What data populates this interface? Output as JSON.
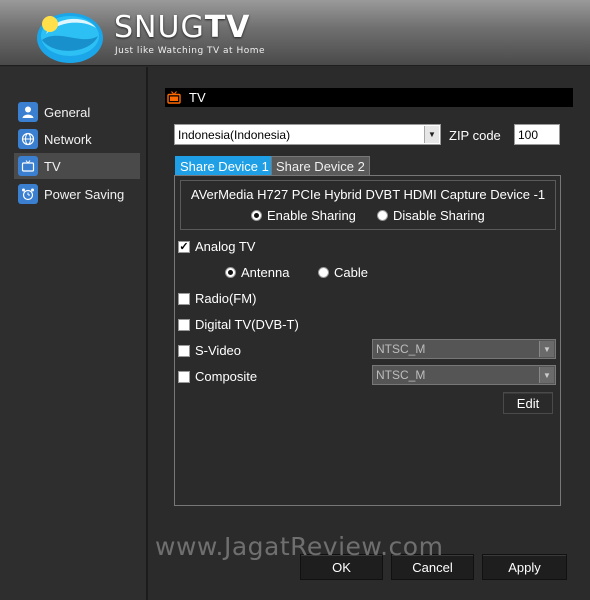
{
  "app": {
    "brand_snug": "SNUG",
    "brand_tv": "TV",
    "tagline": "Just like Watching TV at Home"
  },
  "sidebar": {
    "items": [
      {
        "label": "General",
        "icon": "user-icon",
        "color": "#3a7fd0"
      },
      {
        "label": "Network",
        "icon": "globe-icon",
        "color": "#3a7fd0"
      },
      {
        "label": "TV",
        "icon": "tv-icon",
        "color": "#3a7fd0",
        "active": true
      },
      {
        "label": "Power Saving",
        "icon": "alarm-clock-icon",
        "color": "#3a7fd0"
      }
    ]
  },
  "main": {
    "title": "TV",
    "region": "Indonesia(Indonesia)",
    "zip_label": "ZIP code",
    "zip_value": "100",
    "tabs": [
      {
        "label": "Share Device 1",
        "active": true
      },
      {
        "label": "Share Device 2",
        "active": false
      }
    ],
    "device": {
      "name": "AVerMedia H727 PCIe Hybrid DVBT HDMI Capture Device -1",
      "enable_label": "Enable Sharing",
      "disable_label": "Disable Sharing",
      "sharing": "enable"
    },
    "sources": {
      "analog_label": "Analog TV",
      "analog_checked": true,
      "antenna_label": "Antenna",
      "cable_label": "Cable",
      "analog_input": "antenna",
      "radio_label": "Radio(FM)",
      "digital_label": "Digital TV(DVB-T)",
      "svideo_label": "S-Video",
      "svideo_format": "NTSC_M",
      "composite_label": "Composite",
      "composite_format": "NTSC_M"
    },
    "edit_label": "Edit"
  },
  "footer": {
    "ok_label": "OK",
    "cancel_label": "Cancel",
    "apply_label": "Apply"
  },
  "watermark": "www.JagatReview.com",
  "colors": {
    "accent": "#1fa0e6",
    "tv_icon": "#ff6a00",
    "background": "#2b2b2b"
  }
}
